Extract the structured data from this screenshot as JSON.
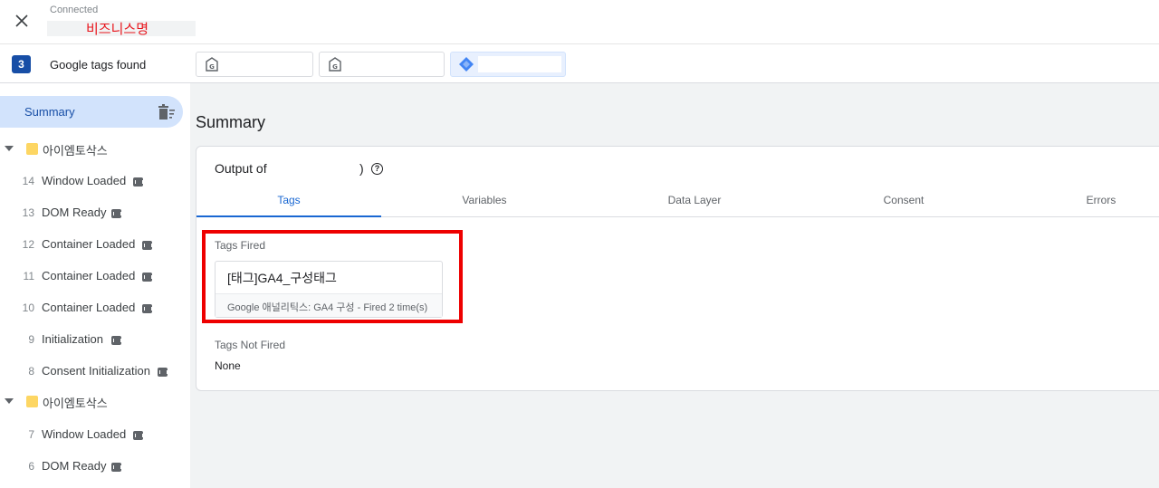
{
  "header": {
    "status": "Connected",
    "site_name": "비즈니스명",
    "close_icon": "close-icon"
  },
  "tagbar": {
    "count": "3",
    "label": "Google tags found",
    "chips": [
      {
        "icon": "google-tag-icon"
      },
      {
        "icon": "google-tag-icon"
      },
      {
        "icon": "gtm-diamond-icon"
      }
    ]
  },
  "sidebar": {
    "summary_label": "Summary",
    "groups": [
      {
        "label": "아이엠토삭스",
        "events": [
          {
            "num": "14",
            "name": "Window Loaded"
          },
          {
            "num": "13",
            "name": "DOM Ready"
          },
          {
            "num": "12",
            "name": "Container Loaded"
          },
          {
            "num": "11",
            "name": "Container Loaded"
          },
          {
            "num": "10",
            "name": "Container Loaded"
          },
          {
            "num": "9",
            "name": "Initialization"
          },
          {
            "num": "8",
            "name": "Consent Initialization"
          }
        ]
      },
      {
        "label": "아이엠토삭스",
        "events": [
          {
            "num": "7",
            "name": "Window Loaded"
          },
          {
            "num": "6",
            "name": "DOM Ready"
          }
        ]
      }
    ]
  },
  "main": {
    "title": "Summary",
    "output_label": "Output of",
    "output_suffix": ")",
    "tabs": [
      "Tags",
      "Variables",
      "Data Layer",
      "Consent",
      "Errors"
    ],
    "active_tab": "Tags",
    "tags_fired_label": "Tags Fired",
    "fired_tag": {
      "name": "[태그]GA4_구성태그",
      "detail": "Google 애널리틱스: GA4 구성 - Fired 2 time(s)"
    },
    "tags_not_fired_label": "Tags Not Fired",
    "not_fired_value": "None"
  },
  "colors": {
    "accent": "#1967d2",
    "highlight": "#ee0000",
    "site_name": "#e8141b"
  }
}
